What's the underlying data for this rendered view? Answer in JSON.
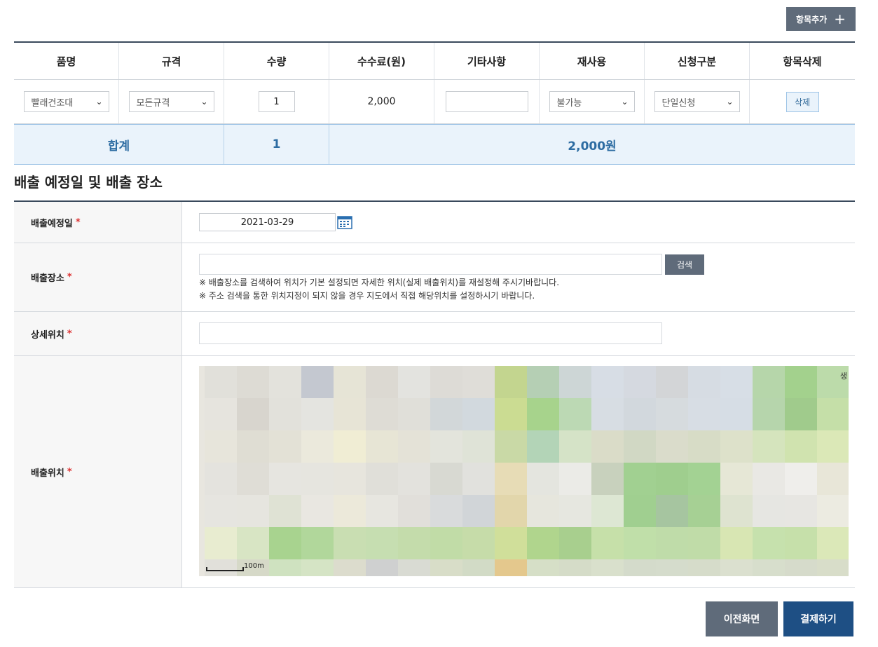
{
  "toolbar": {
    "add_item_label": "항목추가",
    "add_icon": "+"
  },
  "items_table": {
    "headers": [
      "품명",
      "규격",
      "수량",
      "수수료(원)",
      "기타사항",
      "재사용",
      "신청구분",
      "항목삭제"
    ],
    "row": {
      "product": "빨래건조대",
      "spec": "모든규격",
      "quantity": "1",
      "fee": "2,000",
      "note": "",
      "reuse": "불가능",
      "request_type": "단일신청",
      "delete_label": "삭제"
    },
    "total": {
      "label": "합계",
      "quantity": "1",
      "amount": "2,000원"
    }
  },
  "section": {
    "title": "배출 예정일 및 배출 장소"
  },
  "form": {
    "date": {
      "label": "배출예정일",
      "required_mark": "*",
      "value": "2021-03-29"
    },
    "place": {
      "label": "배출장소",
      "required_mark": "*",
      "value": "",
      "search_label": "검색",
      "note1": "※ 배출장소를 검색하여 위치가 기본 설정되면 자세한 위치(실제 배출위치)를 재설정해 주시기바랍니다.",
      "note2": "※ 주소 검색을 통한 위치지정이 되지 않을 경우 지도에서 직접 해당위치를 설정하시기 바랍니다."
    },
    "detail": {
      "label": "상세위치",
      "required_mark": "*",
      "value": ""
    },
    "map": {
      "label": "배출위치",
      "required_mark": "*",
      "scale_label": "100m",
      "edge_text": "생"
    }
  },
  "actions": {
    "prev_label": "이전화면",
    "pay_label": "결제하기"
  },
  "colors": {
    "accent": "#1e4f84",
    "button_gray": "#5f6b7a",
    "total_bg": "#eaf3fb",
    "total_text": "#2d6ca2",
    "required": "#dd3333"
  }
}
